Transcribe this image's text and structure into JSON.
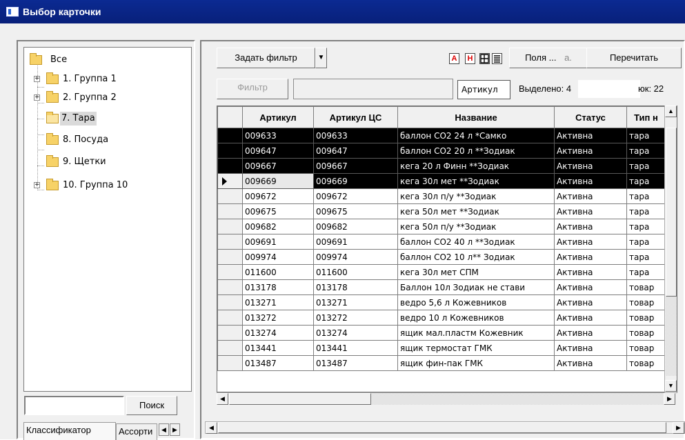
{
  "window": {
    "title": "Выбор карточки"
  },
  "tree": {
    "items": [
      {
        "label": "Все"
      },
      {
        "label": "1. Группа 1"
      },
      {
        "label": "2. Группа 2"
      },
      {
        "label": "7. Тара"
      },
      {
        "label": "8. Посуда"
      },
      {
        "label": "9. Щетки"
      },
      {
        "label": "10. Группа 10"
      }
    ]
  },
  "search": {
    "value": "",
    "button": "Поиск"
  },
  "tabs": [
    "Классификатор",
    "Ассорти"
  ],
  "toolbar": {
    "set_filter": "Задать фильтр",
    "dropdown_arrow": "▼",
    "icon_a": "A",
    "icon_h": "H",
    "fields": "Поля ...",
    "fields_partial": "а.",
    "recount": "Перечитать",
    "filter": "Фильтр",
    "filter_value": "",
    "sort_field": "Артикул",
    "selected_label": "Выделено: 4",
    "partial_label": "юк: 22"
  },
  "grid": {
    "columns": [
      "Артикул",
      "Артикул ЦС",
      "Название",
      "Статус",
      "Тип н"
    ],
    "rows": [
      {
        "art": "009633",
        "artcs": "009633",
        "name": "баллон CO2 24 л  *Самко",
        "status": "Активна",
        "type": "тара",
        "state": "selected"
      },
      {
        "art": "009647",
        "artcs": "009647",
        "name": "баллон CO2 20 л  **Зодиак",
        "status": "Активна",
        "type": "тара",
        "state": "selected"
      },
      {
        "art": "009667",
        "artcs": "009667",
        "name": "кега 20 л Финн **Зодиак",
        "status": "Активна",
        "type": "тара",
        "state": "selected"
      },
      {
        "art": "009669",
        "artcs": "009669",
        "name": "кега 30л мет **Зодиак",
        "status": "Активна",
        "type": "тара",
        "state": "current"
      },
      {
        "art": "009672",
        "artcs": "009672",
        "name": "кега 30л п/у **Зодиак",
        "status": "Активна",
        "type": "тара",
        "state": ""
      },
      {
        "art": "009675",
        "artcs": "009675",
        "name": "кега 50л мет **Зодиак",
        "status": "Активна",
        "type": "тара",
        "state": ""
      },
      {
        "art": "009682",
        "artcs": "009682",
        "name": "кега 50л п/у **Зодиак",
        "status": "Активна",
        "type": "тара",
        "state": ""
      },
      {
        "art": "009691",
        "artcs": "009691",
        "name": "баллон CO2 40 л  **Зодиак",
        "status": "Активна",
        "type": "тара",
        "state": ""
      },
      {
        "art": "009974",
        "artcs": "009974",
        "name": "баллон CO2 10 л** Зодиак",
        "status": "Активна",
        "type": "тара",
        "state": ""
      },
      {
        "art": "011600",
        "artcs": "011600",
        "name": "кега 30л мет СПМ",
        "status": "Активна",
        "type": "тара",
        "state": ""
      },
      {
        "art": "013178",
        "artcs": "013178",
        "name": "Баллон 10л Зодиак не стави",
        "status": "Активна",
        "type": "товар",
        "state": ""
      },
      {
        "art": "013271",
        "artcs": "013271",
        "name": "ведро 5,6 л  Кожевников",
        "status": "Активна",
        "type": "товар",
        "state": ""
      },
      {
        "art": "013272",
        "artcs": "013272",
        "name": "ведро 10 л  Кожевников",
        "status": "Активна",
        "type": "товар",
        "state": ""
      },
      {
        "art": "013274",
        "artcs": "013274",
        "name": "ящик мал.пластм  Кожевник",
        "status": "Активна",
        "type": "товар",
        "state": ""
      },
      {
        "art": "013441",
        "artcs": "013441",
        "name": "ящик термостат ГМК",
        "status": "Активна",
        "type": "товар",
        "state": ""
      },
      {
        "art": "013487",
        "artcs": "013487",
        "name": "ящик фин-пак ГМК",
        "status": "Активна",
        "type": "товар",
        "state": ""
      }
    ]
  },
  "colors": {
    "title_bar": "#0b2a92",
    "selection": "#000000",
    "window_bg": "#f0f0f0"
  }
}
